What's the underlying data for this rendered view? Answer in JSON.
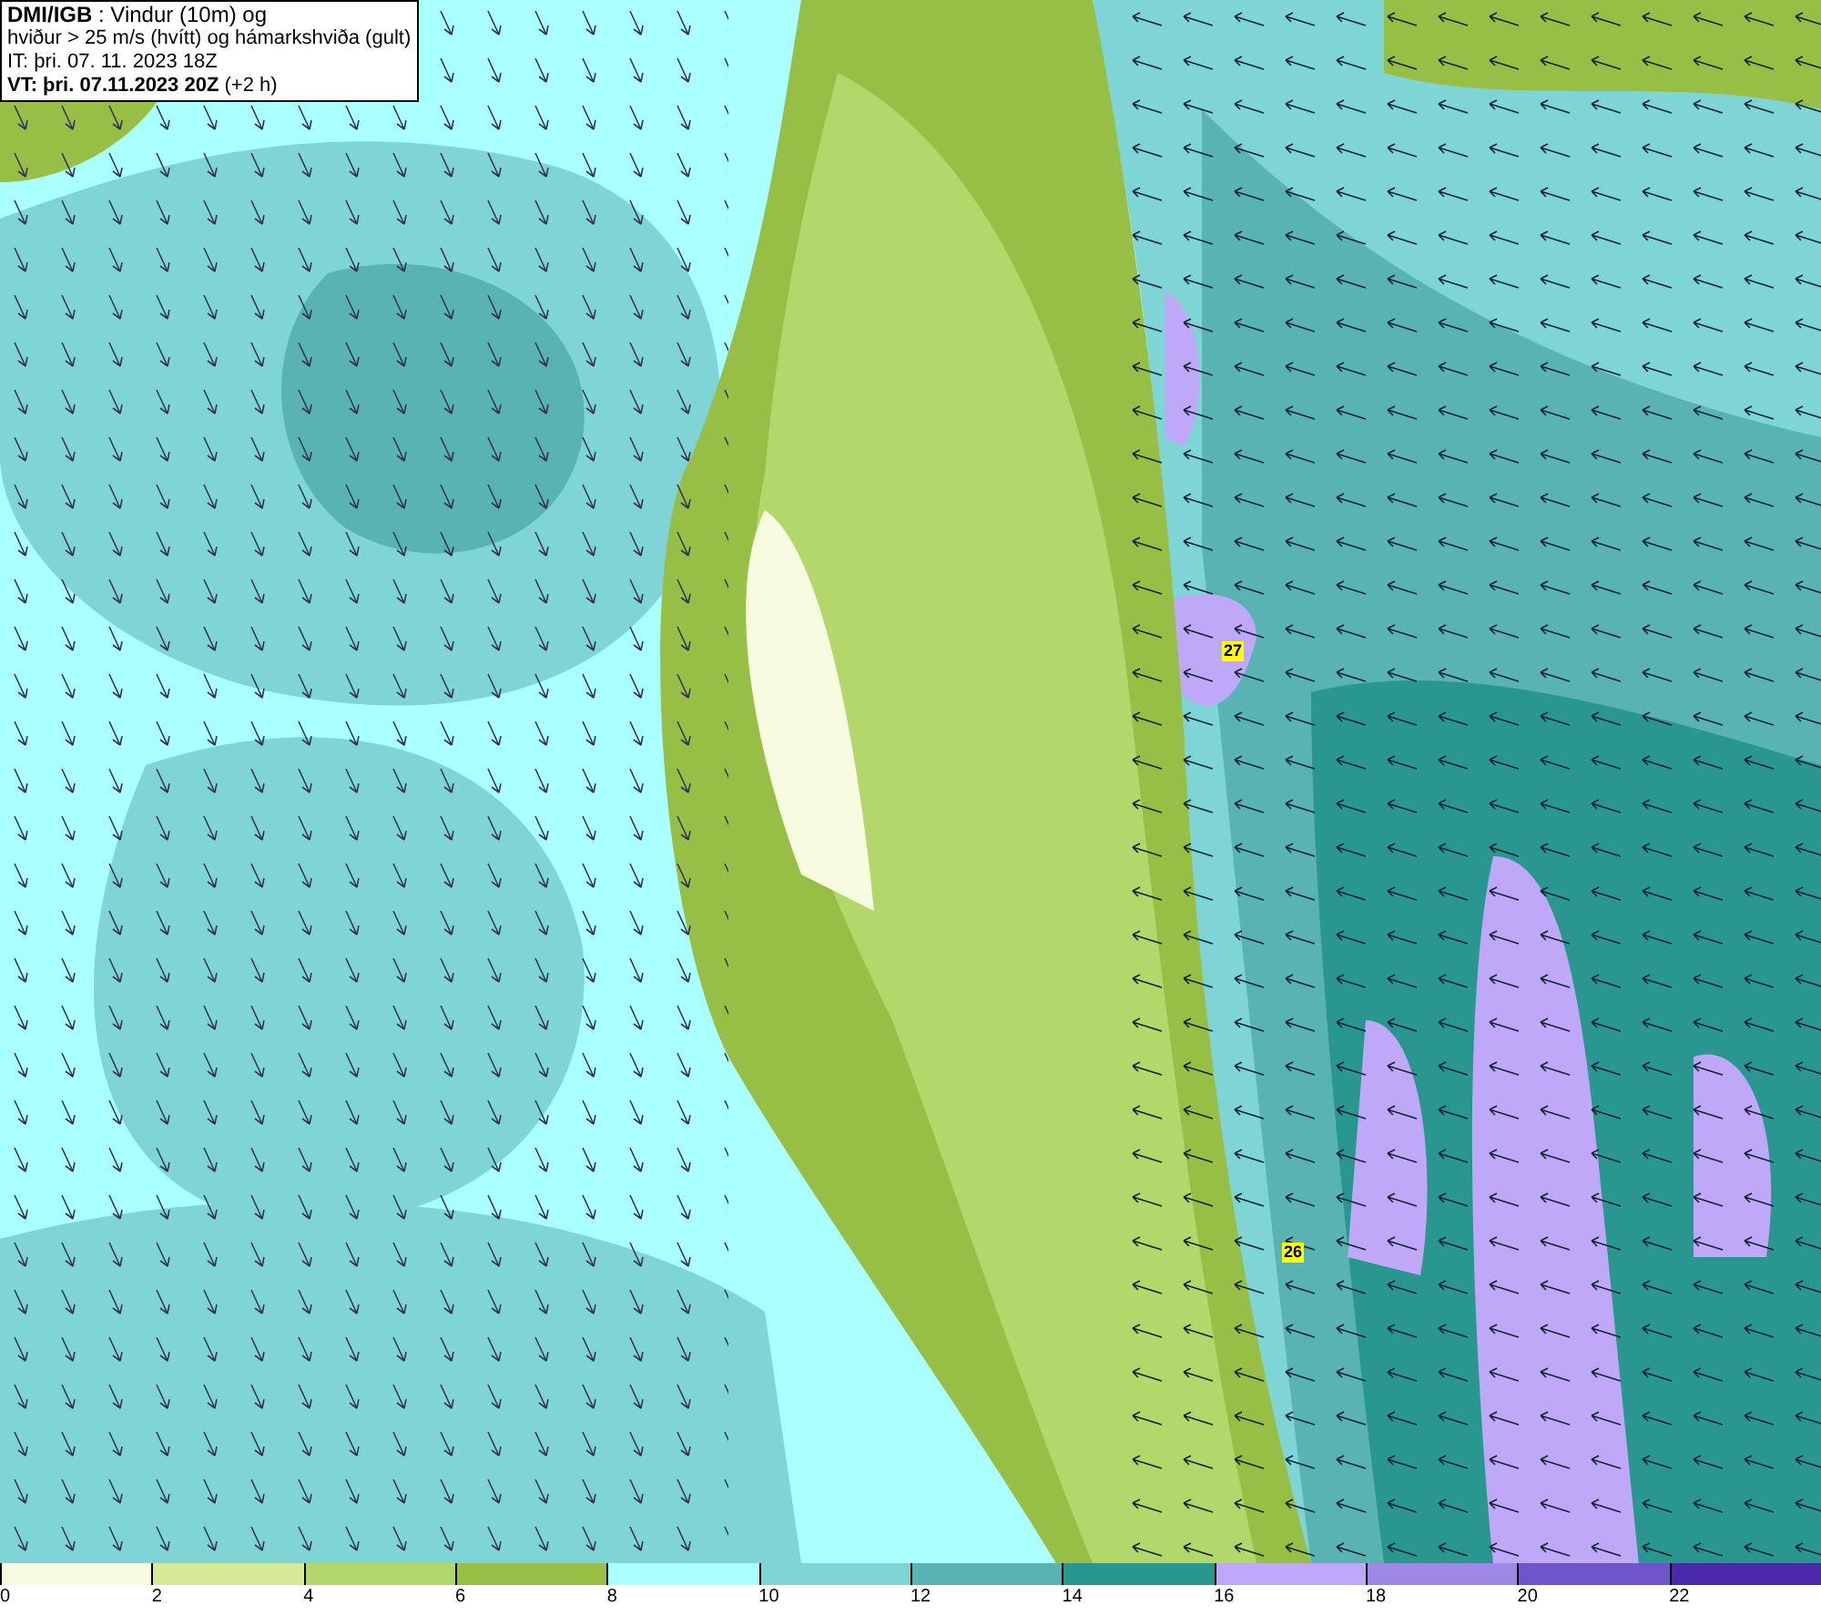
{
  "title_box": {
    "line1": "**DMI/IGB** : Vindur (10m) og",
    "line2": "hviður > 25 m/s (hvítt) og hámarkshviða (gult)",
    "line3": "IT: þri. 07. 11. 2023 18Z",
    "line4": "**VT: þri. 07.11.2023 20Z** (+2 h)"
  },
  "gust_markers": [
    {
      "value": "27"
    },
    {
      "value": "26"
    }
  ],
  "legend": [
    {
      "label": "0",
      "color": "#f7fbe0"
    },
    {
      "label": "2",
      "color": "#d6eb95"
    },
    {
      "label": "4",
      "color": "#b3d76a"
    },
    {
      "label": "6",
      "color": "#98bf45"
    },
    {
      "label": "8",
      "color": "#aaffff"
    },
    {
      "label": "10",
      "color": "#7fd5d5"
    },
    {
      "label": "12",
      "color": "#5ab3b3"
    },
    {
      "label": "14",
      "color": "#2a9690"
    },
    {
      "label": "16",
      "color": "#c0a8f8"
    },
    {
      "label": "18",
      "color": "#9e88e6"
    },
    {
      "label": "20",
      "color": "#6f55cc"
    },
    {
      "label": "22",
      "color": "#4a2aa8"
    }
  ]
}
